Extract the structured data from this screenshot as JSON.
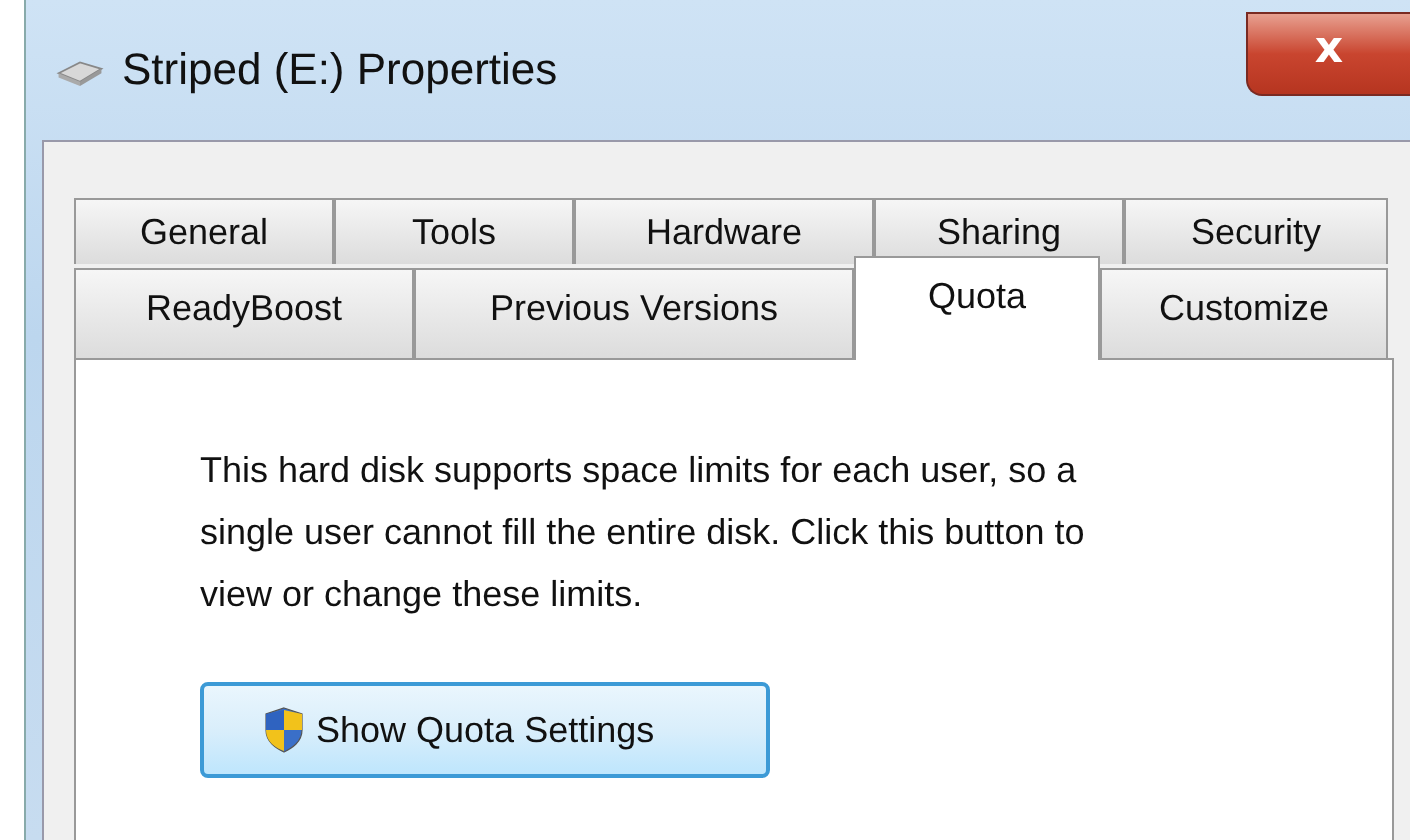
{
  "window": {
    "title": "Striped (E:) Properties",
    "close": "x"
  },
  "tab_rows": [
    [
      {
        "label": "General",
        "selected": false
      },
      {
        "label": "Tools",
        "selected": false
      },
      {
        "label": "Hardware",
        "selected": false
      },
      {
        "label": "Sharing",
        "selected": false
      },
      {
        "label": "Security",
        "selected": false
      }
    ],
    [
      {
        "label": "ReadyBoost",
        "selected": false
      },
      {
        "label": "Previous Versions",
        "selected": false
      },
      {
        "label": "Quota",
        "selected": true
      },
      {
        "label": "Customize",
        "selected": false
      }
    ]
  ],
  "description": "This hard disk supports space limits for each user, so a single user cannot fill the entire disk. Click this button to view or change these limits.",
  "buttons": [
    {
      "label": "Show Quota Settings"
    }
  ]
}
